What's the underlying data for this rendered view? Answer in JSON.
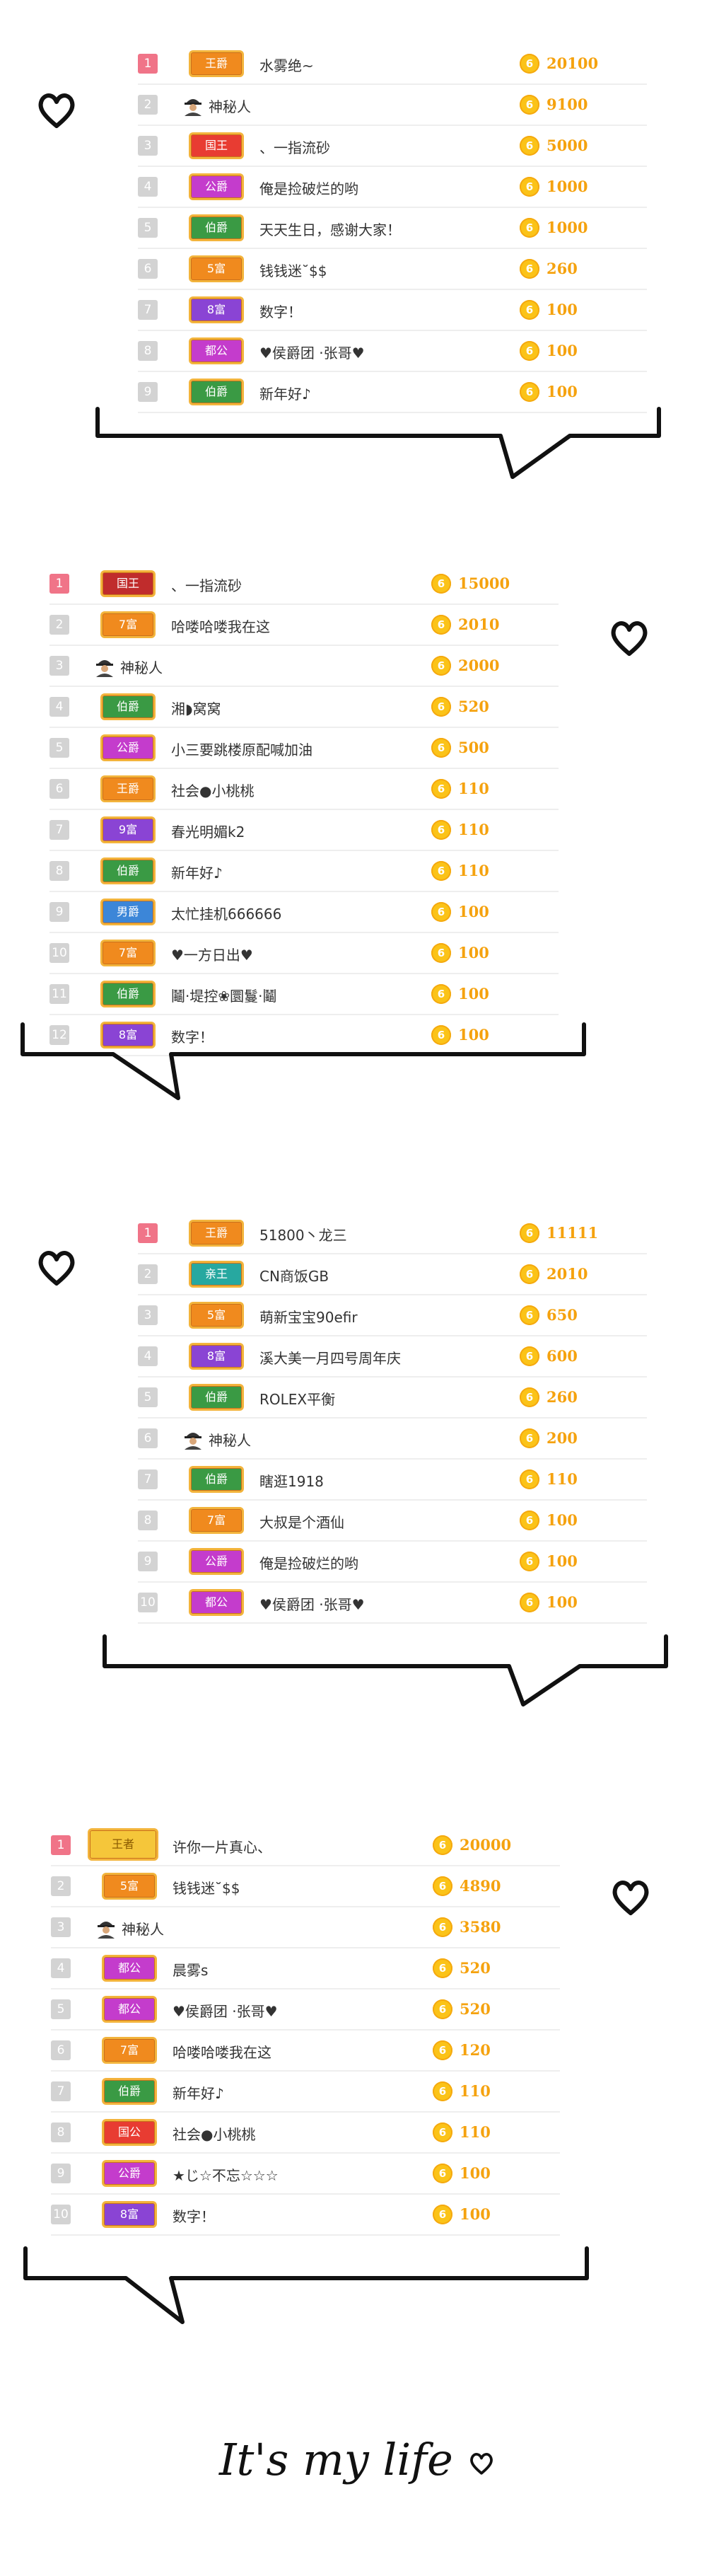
{
  "coin_glyph": "6",
  "tagline": "It's my life",
  "colors": {
    "coin": "#fbc318",
    "amount": "#f5a20e",
    "rank_top": "#f07488",
    "rank": "#d3d3d3"
  },
  "lists": [
    {
      "rows": [
        {
          "rank": "1",
          "badge": "王爵",
          "badge_color": "orange",
          "name": "水雾绝~",
          "amount": "20100"
        },
        {
          "rank": "2",
          "badge": "",
          "avatar": "agent-icon",
          "name": "神秘人",
          "amount": "9100"
        },
        {
          "rank": "3",
          "badge": "国王",
          "badge_color": "red",
          "name": "、一指流砂",
          "amount": "5000"
        },
        {
          "rank": "4",
          "badge": "公爵",
          "badge_color": "magenta",
          "name": "俺是捡破烂的哟",
          "amount": "1000"
        },
        {
          "rank": "5",
          "badge": "伯爵",
          "badge_color": "green",
          "name": "天天生日，感谢大家！",
          "amount": "1000"
        },
        {
          "rank": "6",
          "badge": "5富",
          "badge_color": "orange",
          "name": "钱钱迷˘$$",
          "amount": "260"
        },
        {
          "rank": "7",
          "badge": "8富",
          "badge_color": "purple",
          "name": "数字！",
          "amount": "100"
        },
        {
          "rank": "8",
          "badge": "都公",
          "badge_color": "magenta",
          "name": "♥侯爵团 ·张哥♥",
          "amount": "100"
        },
        {
          "rank": "9",
          "badge": "伯爵",
          "badge_color": "green",
          "name": "新年好♪",
          "amount": "100"
        }
      ]
    },
    {
      "rows": [
        {
          "rank": "1",
          "badge": "国王",
          "badge_color": "darkred",
          "name": "、一指流砂",
          "amount": "15000"
        },
        {
          "rank": "2",
          "badge": "7富",
          "badge_color": "orange",
          "name": "哈喽哈喽我在这",
          "amount": "2010"
        },
        {
          "rank": "3",
          "badge": "",
          "avatar": "agent-icon",
          "name": "神秘人",
          "amount": "2000"
        },
        {
          "rank": "4",
          "badge": "伯爵",
          "badge_color": "green",
          "name": "湘◗窝窝",
          "amount": "520"
        },
        {
          "rank": "5",
          "badge": "公爵",
          "badge_color": "magenta",
          "name": "小三要跳楼原配喊加油",
          "amount": "500"
        },
        {
          "rank": "6",
          "badge": "王爵",
          "badge_color": "orange",
          "name": "社会●小桃桃",
          "amount": "110"
        },
        {
          "rank": "7",
          "badge": "9富",
          "badge_color": "purple",
          "name": "春光明媚k2",
          "amount": "110"
        },
        {
          "rank": "8",
          "badge": "伯爵",
          "badge_color": "green",
          "name": "新年好♪",
          "amount": "110"
        },
        {
          "rank": "9",
          "badge": "男爵",
          "badge_color": "blue",
          "name": "太忙挂机666666",
          "amount": "100"
        },
        {
          "rank": "10",
          "badge": "7富",
          "badge_color": "orange",
          "name": "♥一方日出♥",
          "amount": "100"
        },
        {
          "rank": "11",
          "badge": "伯爵",
          "badge_color": "green",
          "name": "鬮·堤控❀圜鬘·鬮",
          "amount": "100"
        },
        {
          "rank": "12",
          "badge": "8富",
          "badge_color": "purple",
          "name": "数字！",
          "amount": "100"
        }
      ]
    },
    {
      "rows": [
        {
          "rank": "1",
          "badge": "王爵",
          "badge_color": "orange",
          "name": "51800丶龙三",
          "amount": "11111"
        },
        {
          "rank": "2",
          "badge": "亲王",
          "badge_color": "teal",
          "name": "CN商饭GB",
          "amount": "2010"
        },
        {
          "rank": "3",
          "badge": "5富",
          "badge_color": "orange",
          "name": "萌新宝宝90efir",
          "amount": "650"
        },
        {
          "rank": "4",
          "badge": "8富",
          "badge_color": "purple",
          "name": "溪大美一月四号周年庆",
          "amount": "600"
        },
        {
          "rank": "5",
          "badge": "伯爵",
          "badge_color": "green",
          "name": "ROLEX平衡",
          "amount": "260"
        },
        {
          "rank": "6",
          "badge": "",
          "avatar": "agent-icon",
          "name": "神秘人",
          "amount": "200"
        },
        {
          "rank": "7",
          "badge": "伯爵",
          "badge_color": "green",
          "name": "瞎逛1918",
          "amount": "110"
        },
        {
          "rank": "8",
          "badge": "7富",
          "badge_color": "orange",
          "name": "大叔是个酒仙",
          "amount": "100"
        },
        {
          "rank": "9",
          "badge": "公爵",
          "badge_color": "magenta",
          "name": "俺是捡破烂的哟",
          "amount": "100"
        },
        {
          "rank": "10",
          "badge": "都公",
          "badge_color": "magenta",
          "name": "♥侯爵团 ·张哥♥",
          "amount": "100"
        }
      ]
    },
    {
      "rows": [
        {
          "rank": "1",
          "badge": "",
          "crown": "王者",
          "name": "许你一片真心、",
          "amount": "20000"
        },
        {
          "rank": "2",
          "badge": "5富",
          "badge_color": "orange",
          "name": "钱钱迷˘$$",
          "amount": "4890"
        },
        {
          "rank": "3",
          "badge": "",
          "avatar": "agent-icon",
          "name": "神秘人",
          "amount": "3580"
        },
        {
          "rank": "4",
          "badge": "都公",
          "badge_color": "magenta",
          "name": "晨雾s",
          "amount": "520"
        },
        {
          "rank": "5",
          "badge": "都公",
          "badge_color": "magenta",
          "name": "♥侯爵团 ·张哥♥",
          "amount": "520"
        },
        {
          "rank": "6",
          "badge": "7富",
          "badge_color": "orange",
          "name": "哈喽哈喽我在这",
          "amount": "120"
        },
        {
          "rank": "7",
          "badge": "伯爵",
          "badge_color": "green",
          "name": "新年好♪",
          "amount": "110"
        },
        {
          "rank": "8",
          "badge": "国公",
          "badge_color": "red",
          "name": "社会●小桃桃",
          "amount": "110"
        },
        {
          "rank": "9",
          "badge": "公爵",
          "badge_color": "magenta",
          "name": "★じ☆不忘☆☆☆",
          "amount": "100"
        },
        {
          "rank": "10",
          "badge": "8富",
          "badge_color": "purple",
          "name": "数字！",
          "amount": "100"
        }
      ]
    }
  ]
}
